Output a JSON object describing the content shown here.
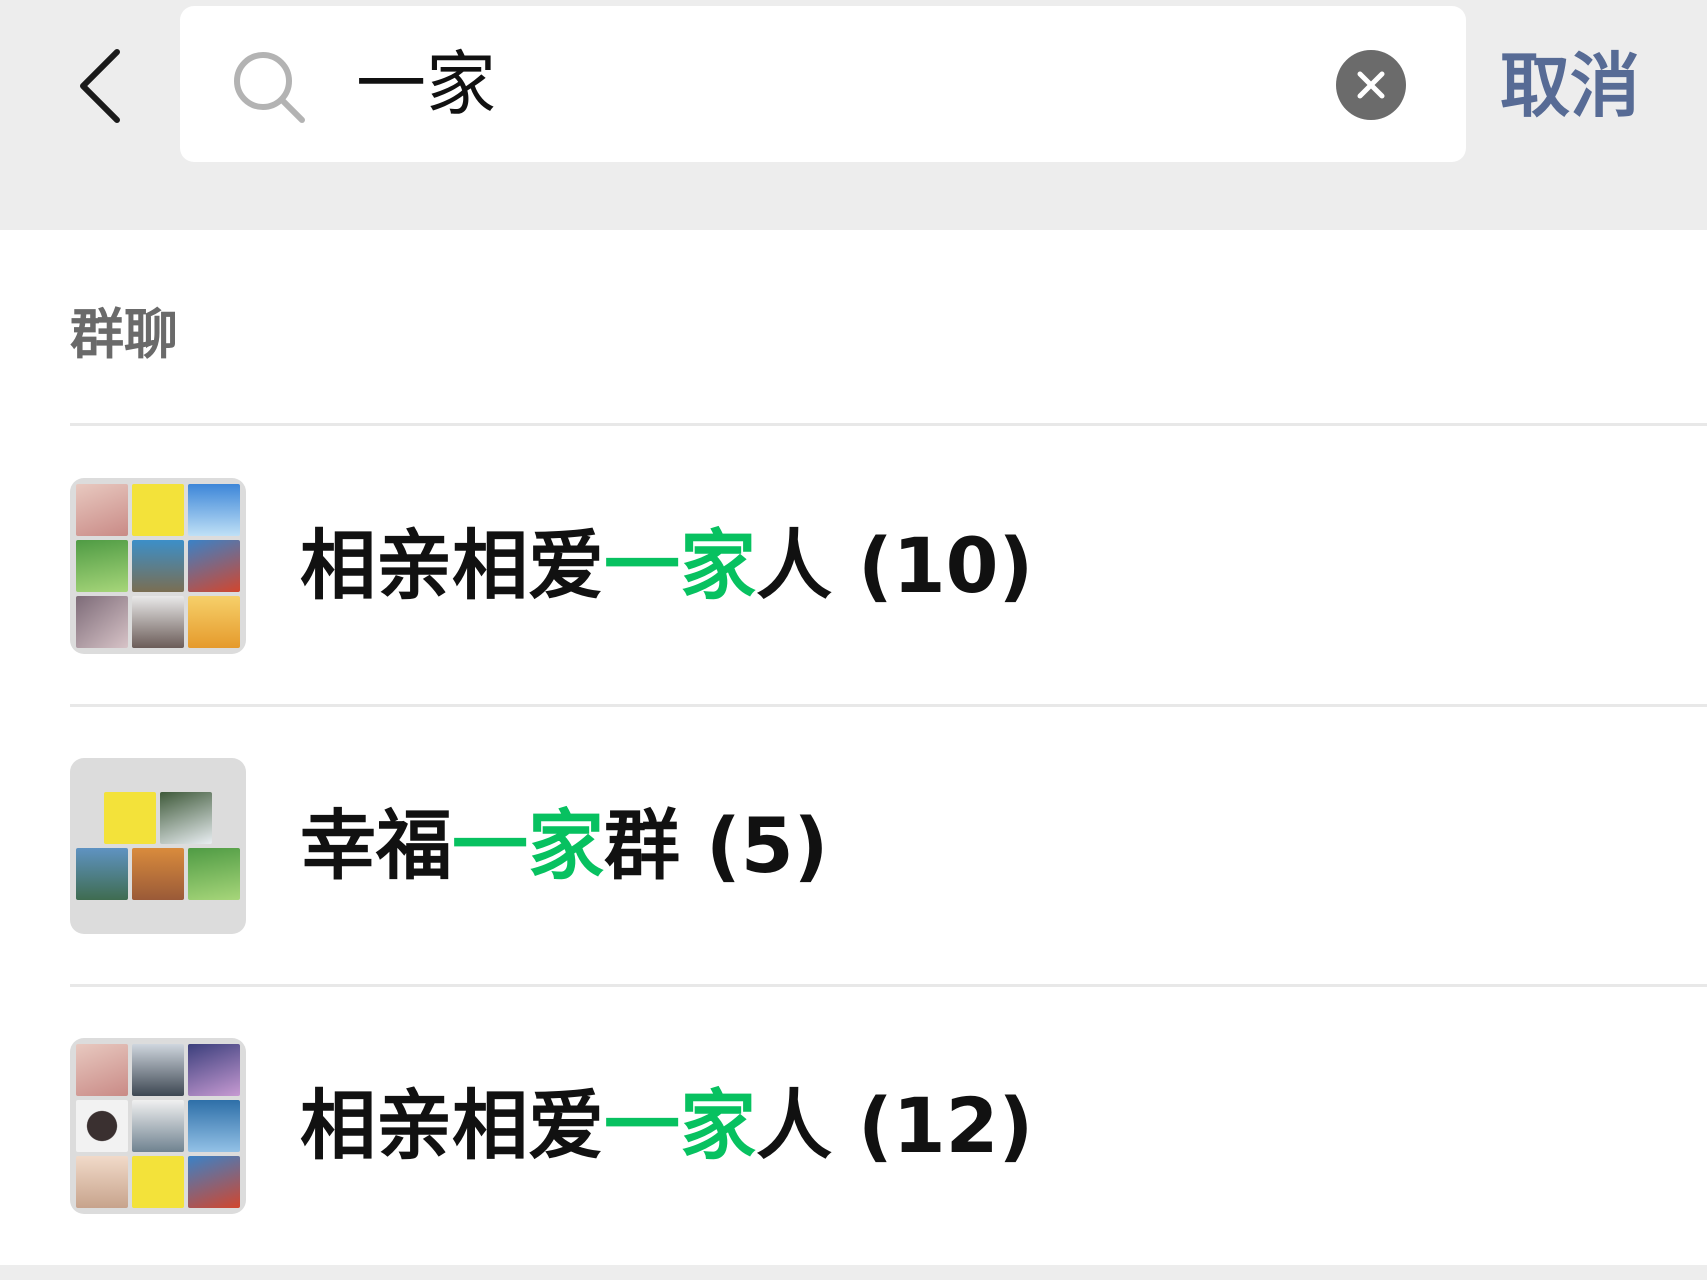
{
  "header": {
    "search_query": "一家",
    "cancel_label": "取消",
    "icons": {
      "back": "chevron-left-icon",
      "search": "search-icon",
      "clear": "clear-icon"
    }
  },
  "results": {
    "section_title": "群聊",
    "items": [
      {
        "name_before": "相亲相爱",
        "name_match": "一家",
        "name_after": "人",
        "count": "(10)",
        "avatar_layout": "3x3"
      },
      {
        "name_before": "幸福",
        "name_match": "一家",
        "name_after": "群",
        "count": "(5)",
        "avatar_layout": "2-3"
      },
      {
        "name_before": "相亲相爱",
        "name_match": "一家",
        "name_after": "人",
        "count": "(12)",
        "avatar_layout": "3x3"
      }
    ]
  },
  "colors": {
    "background": "#ededed",
    "panel": "#ffffff",
    "highlight": "#07c160",
    "link": "#576b95",
    "divider": "#e8e8e8",
    "text": "#111111",
    "secondary_text": "#6a6a6a"
  }
}
